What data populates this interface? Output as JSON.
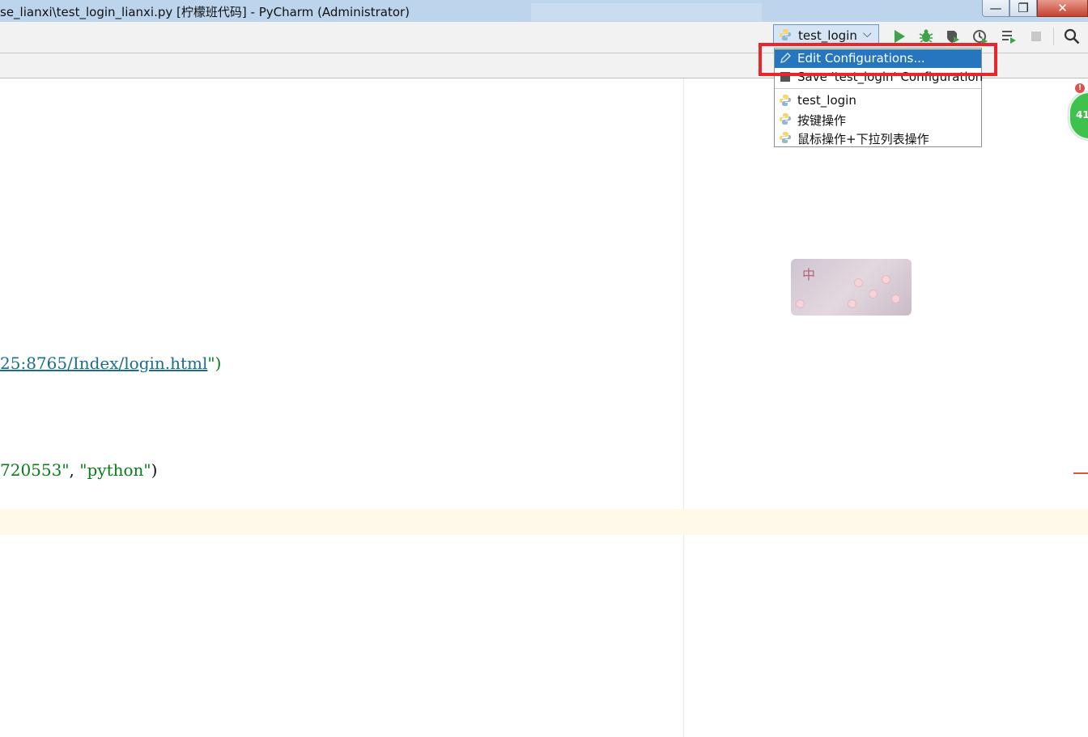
{
  "window": {
    "title": "se_lianxi\\test_login_lianxi.py [柠檬班代码] - PyCharm (Administrator)",
    "controls": {
      "minimize": "—",
      "maximize": "❐",
      "close": "✕"
    }
  },
  "toolbar": {
    "run_config_label": "test_login",
    "icons": [
      "run-icon",
      "debug-icon",
      "coverage-icon",
      "profile-icon",
      "concurrency-icon",
      "stop-icon",
      "search-icon"
    ]
  },
  "editor": {
    "line1_url": "25:8765/Index/login.html",
    "line1_quote_open": "\"",
    "line1_quote_close": "\")",
    "line2_arg1": "720553\"",
    "line2_sep": ", ",
    "line2_arg2": "\"python\"",
    "line2_close": ")"
  },
  "run_menu": {
    "items": [
      {
        "label": "Edit Configurations...",
        "icon": "edit-config-icon",
        "selected": true
      },
      {
        "label": "Save 'test_login' Configuration",
        "icon": "save-icon",
        "selected": false
      },
      {
        "label": "test_login",
        "icon": "python-icon",
        "selected": false
      },
      {
        "label": "按键操作",
        "icon": "python-icon",
        "selected": false
      },
      {
        "label": "鼠标操作+下拉列表操作",
        "icon": "python-icon",
        "selected": false
      }
    ]
  },
  "overlays": {
    "green_badge": "41",
    "sakura_char": "中"
  },
  "colors": {
    "selection": "#2675bf",
    "highlight_border": "#e8262b",
    "caret_row": "#fef9e8"
  }
}
